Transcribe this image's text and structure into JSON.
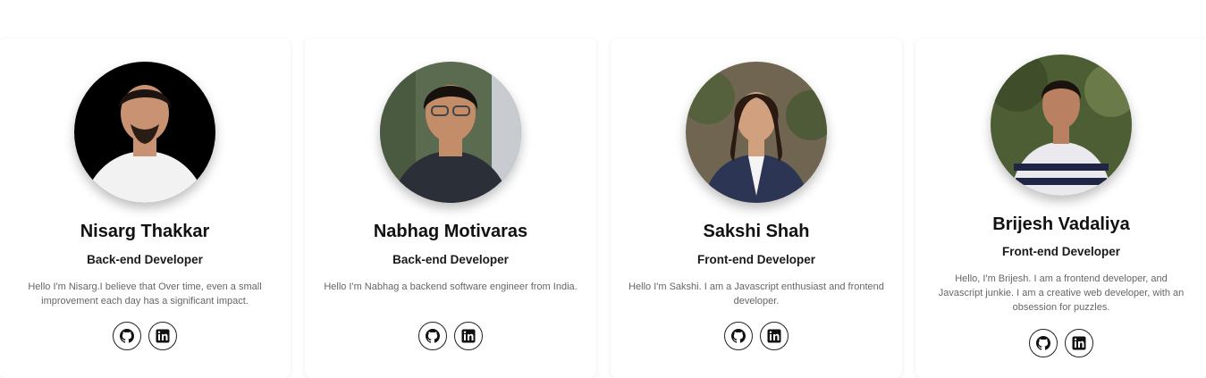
{
  "team": [
    {
      "name": "Nisarg Thakkar",
      "role": "Back-end Developer",
      "bio": "Hello I'm Nisarg.I believe that Over time, even a small improvement each day has a significant impact.",
      "photo_bg": "#000000",
      "shirt": "#f2f2f2",
      "skin": "#c99272",
      "hair": "#1b1411"
    },
    {
      "name": "Nabhag Motivaras",
      "role": "Back-end Developer",
      "bio": "Hello I'm Nabhag a backend software engineer from India.",
      "photo_bg": "#5b6b4f",
      "shirt": "#2a2f38",
      "skin": "#c48d6a",
      "hair": "#17110e"
    },
    {
      "name": "Sakshi Shah",
      "role": "Front-end Developer",
      "bio": "Hello I'm Sakshi. I am a Javascript enthusiast and frontend developer.",
      "photo_bg": "#6f6550",
      "shirt": "#2c3553",
      "skin": "#d1a07f",
      "hair": "#2a1a12"
    },
    {
      "name": "Brijesh Vadaliya",
      "role": "Front-end Developer",
      "bio": "Hello, I'm Brijesh. I am a frontend developer, and Javascript junkie. I am a creative web developer, with an obsession for puzzles.",
      "photo_bg": "#4d5e35",
      "shirt": "#e9e9ee",
      "skin": "#b98062",
      "hair": "#19120d"
    }
  ],
  "icons": {
    "github": "github-icon",
    "linkedin": "linkedin-icon"
  }
}
